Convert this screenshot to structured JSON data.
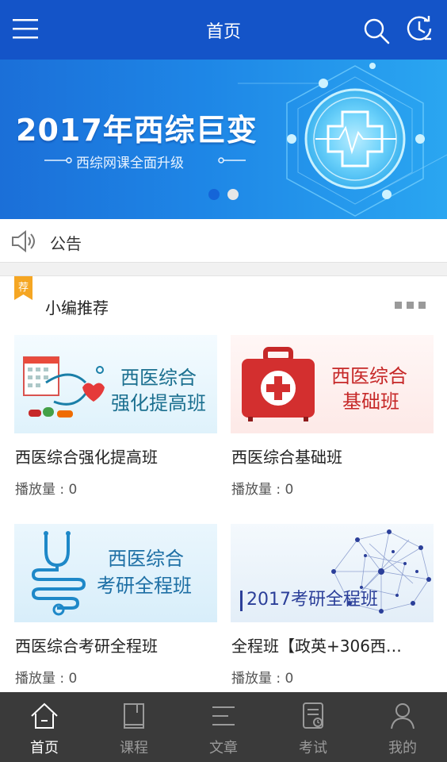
{
  "header": {
    "title": "首页",
    "menu_icon": "hamburger-menu-icon",
    "search_icon": "search-icon",
    "history_icon": "clock-history-icon",
    "bg_color": "#1454c8"
  },
  "banner": {
    "headline": "2017年西综巨变",
    "subline": "西综网课全面升级",
    "slides_total": 2,
    "active_slide": 1
  },
  "notice": {
    "icon": "speaker-icon",
    "label": "公告"
  },
  "recommend": {
    "badge_text": "荐",
    "title": "小编推荐",
    "more_icon": "more-dots-icon",
    "courses": [
      {
        "thumb_line1": "西医综合",
        "thumb_line2": "强化提高班",
        "name": "西医综合强化提高班",
        "plays": "播放量 : 0"
      },
      {
        "thumb_line1": "西医综合",
        "thumb_line2": "基础班",
        "name": "西医综合基础班",
        "plays": "播放量 : 0"
      },
      {
        "thumb_line1": "西医综合",
        "thumb_line2": "考研全程班",
        "name": "西医综合考研全程班",
        "plays": "播放量 : 0"
      },
      {
        "thumb_line1": "2017考研全程班",
        "name": "全程班【政英+306西…",
        "plays": "播放量 : 0"
      }
    ]
  },
  "bottom_nav": [
    {
      "label": "首页",
      "icon": "home-icon",
      "active": true
    },
    {
      "label": "课程",
      "icon": "book-icon",
      "active": false
    },
    {
      "label": "文章",
      "icon": "article-lines-icon",
      "active": false
    },
    {
      "label": "考试",
      "icon": "exam-clipboard-icon",
      "active": false
    },
    {
      "label": "我的",
      "icon": "user-icon",
      "active": false
    }
  ],
  "colors": {
    "accent": "#1454c8",
    "badge": "#f5a623",
    "nav_bg": "#3a3a3a",
    "nav_active": "#ffffff",
    "nav_inactive": "#9a9a9a"
  }
}
